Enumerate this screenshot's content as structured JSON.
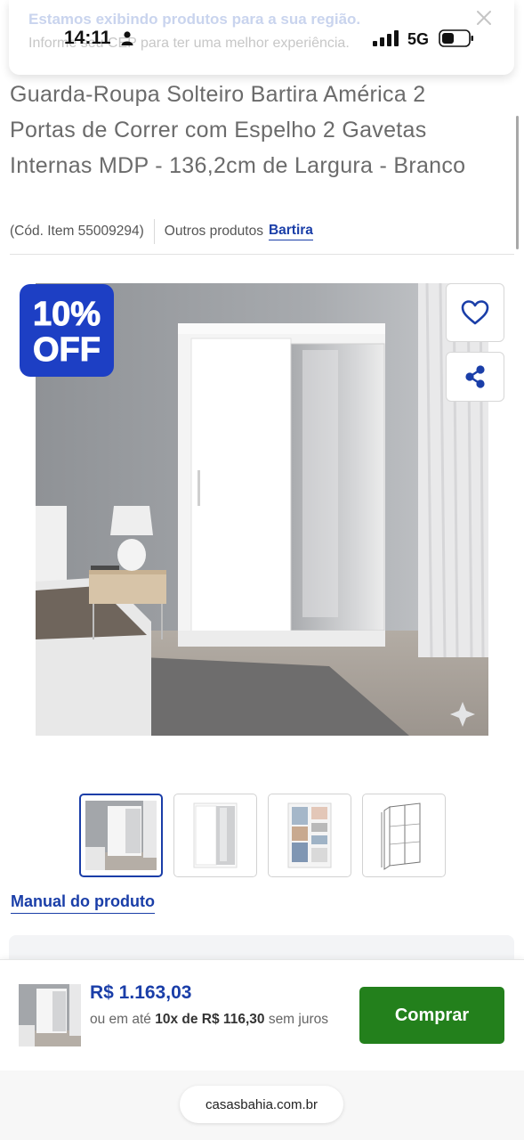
{
  "status_bar": {
    "time": "14:11",
    "network": "5G"
  },
  "region_banner": {
    "title": "Estamos exibindo produtos para a sua região.",
    "subtitle": "Informe seu CEP para ter uma melhor experiência."
  },
  "product": {
    "title": "Guarda-Roupa Solteiro Bartira América 2 Portas de Correr com Espelho 2 Gavetas Internas MDP - 136,2cm de Largura - Branco",
    "item_code": "(Cód. Item 55009294)",
    "other_products_label": "Outros produtos",
    "brand": "Bartira",
    "discount_badge": {
      "line1": "10%",
      "line2": "OFF"
    },
    "manual_link": "Manual do produto",
    "thumbnails": [
      {
        "name": "bedroom-photo",
        "active": true
      },
      {
        "name": "front-view",
        "active": false
      },
      {
        "name": "interior-view",
        "active": false
      },
      {
        "name": "dimensions-drawing",
        "active": false
      }
    ]
  },
  "buy_bar": {
    "price": "R$ 1.163,03",
    "installments_prefix": "ou em até",
    "installments_bold": "10x de R$ 116,30",
    "installments_suffix": "sem juros",
    "button_label": "Comprar"
  },
  "browser": {
    "url": "casasbahia.com.br"
  },
  "colors": {
    "accent_blue": "#1a3ea8",
    "buy_green": "#23801c",
    "badge_blue": "#1d3fc4"
  },
  "icons": [
    "person-icon",
    "signal-icon",
    "battery-icon",
    "close-icon",
    "heart-icon",
    "share-icon",
    "sparkle-icon"
  ]
}
